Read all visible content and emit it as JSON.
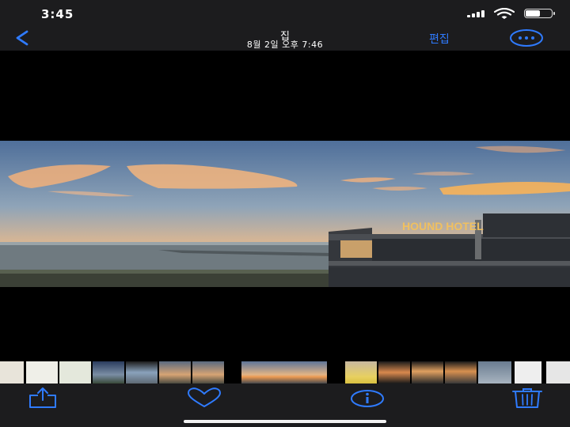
{
  "status": {
    "time": "3:45",
    "signal_icon": "cellular-signal-icon",
    "wifi_icon": "wifi-icon",
    "battery_icon": "battery-icon",
    "battery_level": 0.6
  },
  "nav": {
    "back_icon": "chevron-left-icon",
    "title": "집",
    "subtitle": "8월 2일 오후 7:46",
    "edit_label": "편집",
    "more_icon": "more-ellipsis-icon",
    "accent": "#2f7bff"
  },
  "photo": {
    "sign_text": "HOUND HOTEL"
  },
  "toolbar": {
    "share_icon": "share-icon",
    "favorite_icon": "heart-icon",
    "info_icon": "info-icon",
    "delete_icon": "trash-icon"
  }
}
